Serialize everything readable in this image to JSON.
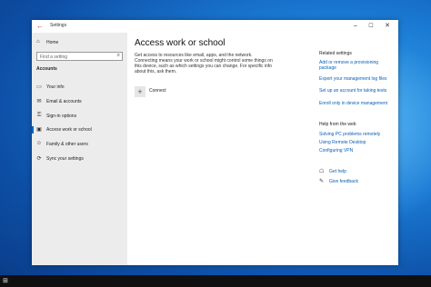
{
  "window": {
    "title": "Settings"
  },
  "sidebar": {
    "home_label": "Home",
    "search_placeholder": "Find a setting",
    "section_heading": "Accounts",
    "items": [
      {
        "label": "Your info",
        "icon": "person-icon"
      },
      {
        "label": "Email & accounts",
        "icon": "mail-icon"
      },
      {
        "label": "Sign-in options",
        "icon": "key-icon"
      },
      {
        "label": "Access work or school",
        "icon": "briefcase-icon",
        "active": true
      },
      {
        "label": "Family & other users",
        "icon": "people-icon"
      },
      {
        "label": "Sync your settings",
        "icon": "sync-icon"
      }
    ]
  },
  "main": {
    "title": "Access work or school",
    "description": "Get access to resources like email, apps, and the network. Connecting means your work or school might control some things on this device, such as which settings you can change. For specific info about this, ask them.",
    "connect_label": "Connect"
  },
  "related": {
    "heading": "Related settings",
    "links": [
      "Add or remove a provisioning package",
      "Export your management log files",
      "Set up an account for taking tests",
      "Enroll only in device management"
    ]
  },
  "help": {
    "heading": "Help from the web",
    "links": [
      "Solving PC problems remotely",
      "Using Remote Desktop",
      "Configuring VPN"
    ],
    "get_help": "Get help",
    "give_feedback": "Give feedback"
  },
  "colors": {
    "accent": "#0067c0",
    "link": "#0a5fb4",
    "sidebar_bg": "#ececec"
  }
}
